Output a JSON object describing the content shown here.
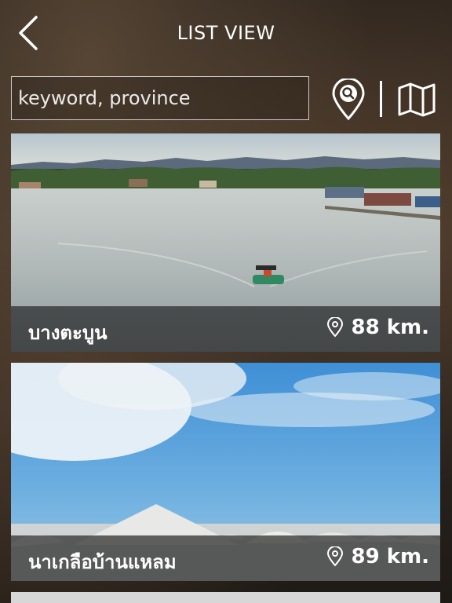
{
  "header": {
    "title": "LIST VIEW"
  },
  "search": {
    "placeholder": "keyword, province"
  },
  "places": [
    {
      "name": "บางตะบูน",
      "distance": "88 km."
    },
    {
      "name": "นาเกลือบ้านแหลม",
      "distance": "89 km."
    }
  ],
  "icons": {
    "back": "back-chevron-icon",
    "location_search": "location-search-icon",
    "map": "map-icon",
    "pin": "location-pin-icon"
  },
  "colors": {
    "text": "#ffffff",
    "caption_bg": "#282828"
  }
}
